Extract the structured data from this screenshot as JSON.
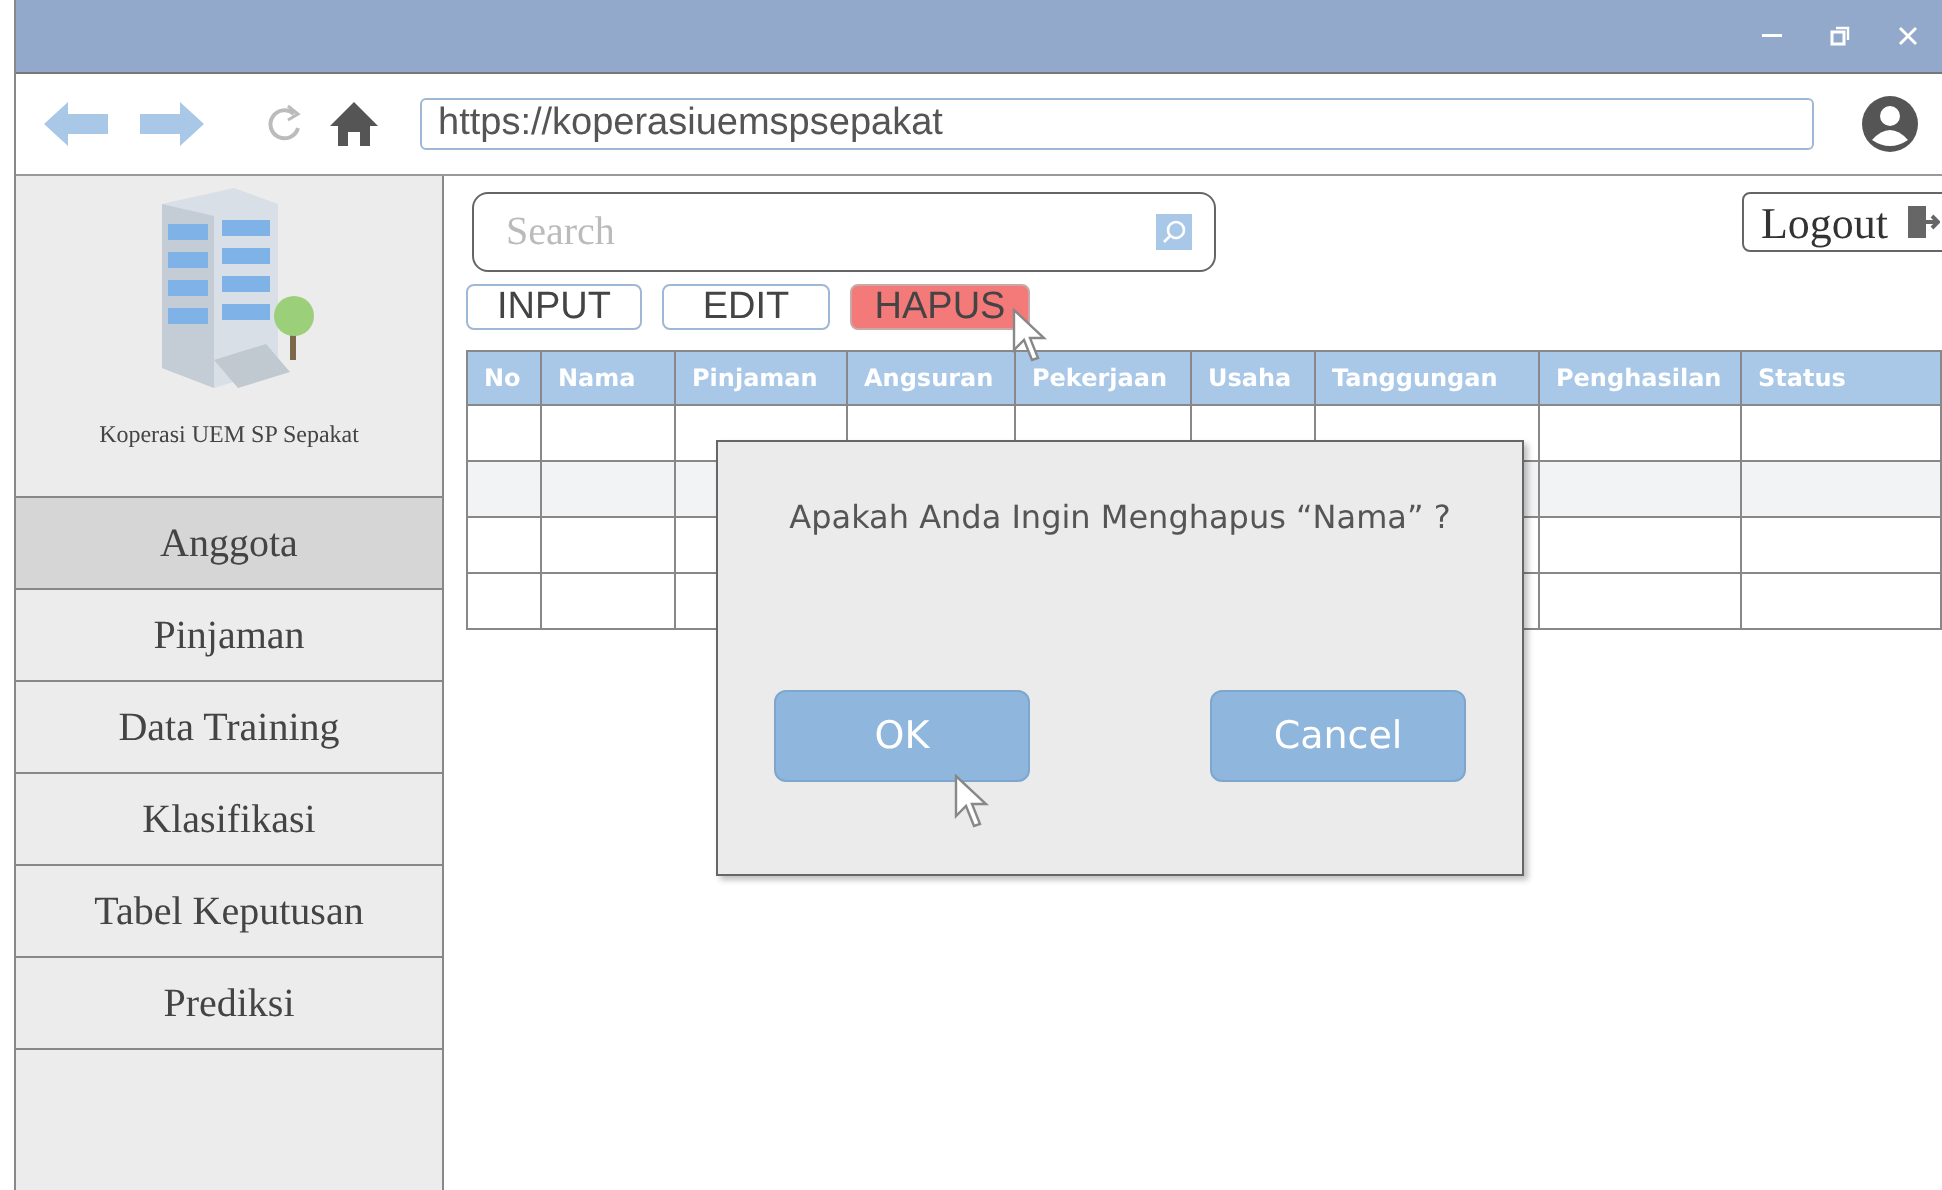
{
  "browser": {
    "url": "https://koperasiuemspsepakat"
  },
  "sidebar": {
    "logo_caption": "Koperasi UEM SP Sepakat",
    "items": [
      {
        "label": "Anggota",
        "selected": true
      },
      {
        "label": "Pinjaman",
        "selected": false
      },
      {
        "label": "Data Training",
        "selected": false
      },
      {
        "label": "Klasifikasi",
        "selected": false
      },
      {
        "label": "Tabel Keputusan",
        "selected": false
      },
      {
        "label": "Prediksi",
        "selected": false
      }
    ]
  },
  "search": {
    "placeholder": "Search"
  },
  "logout": {
    "label": "Logout"
  },
  "actions": [
    {
      "label": "INPUT",
      "highlighted": false
    },
    {
      "label": "EDIT",
      "highlighted": false
    },
    {
      "label": "HAPUS",
      "highlighted": true
    }
  ],
  "table": {
    "columns": [
      "No",
      "Nama",
      "Pinjaman",
      "Angsuran",
      "Pekerjaan",
      "Usaha",
      "Tanggungan",
      "Penghasilan",
      "Status"
    ]
  },
  "dialog": {
    "message": "Apakah Anda Ingin Menghapus “Nama” ?",
    "buttons": [
      "OK",
      "Cancel"
    ]
  }
}
